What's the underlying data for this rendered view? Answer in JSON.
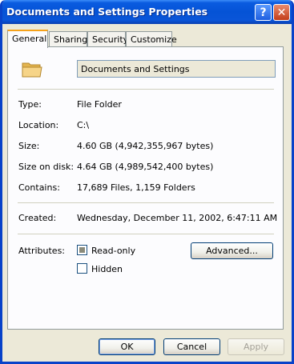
{
  "window": {
    "title": "Documents and Settings Properties",
    "help_glyph": "?",
    "close_glyph": "✕"
  },
  "tabs": [
    "General",
    "Sharing",
    "Security",
    "Customize"
  ],
  "general": {
    "icon": "folder-icon",
    "name": "Documents and Settings",
    "rows": [
      {
        "label": "Type:",
        "value": "File Folder"
      },
      {
        "label": "Location:",
        "value": "C:\\"
      },
      {
        "label": "Size:",
        "value": "4.60 GB (4,942,355,967 bytes)"
      },
      {
        "label": "Size on disk:",
        "value": "4.64 GB (4,989,542,400 bytes)"
      },
      {
        "label": "Contains:",
        "value": "17,689 Files, 1,159 Folders"
      }
    ],
    "created_label": "Created:",
    "created_value": "Wednesday, December 11, 2002, 6:47:11 AM",
    "attributes_label": "Attributes:",
    "readonly_label": "Read-only",
    "hidden_label": "Hidden",
    "advanced_label": "Advanced..."
  },
  "buttons": {
    "ok": "OK",
    "cancel": "Cancel",
    "apply": "Apply"
  },
  "colors": {
    "titlebar": "#0553d6",
    "dialog_bg": "#ece9d8",
    "active_tab_accent": "#f6a21a"
  }
}
